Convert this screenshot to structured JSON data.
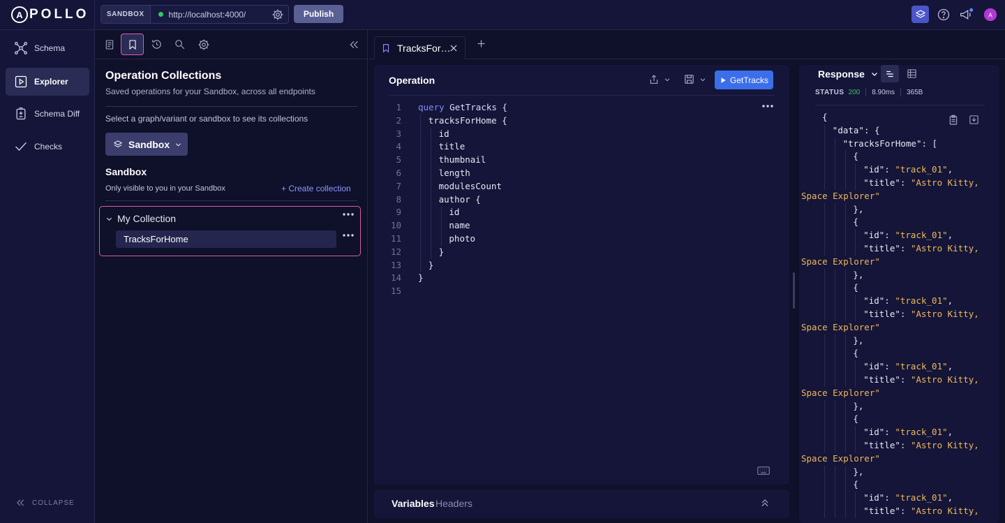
{
  "topbar": {
    "logo_text": "POLLO",
    "logo_letter": "A",
    "sandbox_badge": "SANDBOX",
    "url": "http://localhost:4000/",
    "publish_label": "Publish",
    "status_color": "#36c46a"
  },
  "nav": {
    "items": [
      {
        "label": "Schema",
        "icon": "schema-graph-icon"
      },
      {
        "label": "Explorer",
        "icon": "explorer-play-icon",
        "active": true
      },
      {
        "label": "Schema Diff",
        "icon": "schema-diff-icon"
      },
      {
        "label": "Checks",
        "icon": "checkmark-icon"
      }
    ],
    "collapse_label": "COLLAPSE"
  },
  "collections": {
    "title": "Operation Collections",
    "subtitle": "Saved operations for your Sandbox, across all endpoints",
    "select_hint": "Select a graph/variant or sandbox to see its collections",
    "dropdown_label": "Sandbox",
    "section_title": "Sandbox",
    "section_sub": "Only visible to you in your Sandbox",
    "create_label": "+ Create collection",
    "collection_name": "My Collection",
    "operations": [
      "TracksForHome"
    ]
  },
  "editor": {
    "tab_label": "TracksFor…",
    "panel_title": "Operation",
    "run_label": "GetTracks",
    "code_lines": [
      {
        "n": "1",
        "indent": 0,
        "kw": "query",
        "text": " GetTracks {"
      },
      {
        "n": "2",
        "indent": 1,
        "kw": "",
        "text": "tracksForHome {"
      },
      {
        "n": "3",
        "indent": 2,
        "kw": "",
        "text": "id"
      },
      {
        "n": "4",
        "indent": 2,
        "kw": "",
        "text": "title"
      },
      {
        "n": "5",
        "indent": 2,
        "kw": "",
        "text": "thumbnail"
      },
      {
        "n": "6",
        "indent": 2,
        "kw": "",
        "text": "length"
      },
      {
        "n": "7",
        "indent": 2,
        "kw": "",
        "text": "modulesCount"
      },
      {
        "n": "8",
        "indent": 2,
        "kw": "",
        "text": "author {"
      },
      {
        "n": "9",
        "indent": 3,
        "kw": "",
        "text": "id"
      },
      {
        "n": "10",
        "indent": 3,
        "kw": "",
        "text": "name"
      },
      {
        "n": "11",
        "indent": 3,
        "kw": "",
        "text": "photo"
      },
      {
        "n": "12",
        "indent": 2,
        "kw": "",
        "text": "}"
      },
      {
        "n": "13",
        "indent": 1,
        "kw": "",
        "text": "}"
      },
      {
        "n": "14",
        "indent": 0,
        "kw": "",
        "text": "}"
      },
      {
        "n": "15",
        "indent": 0,
        "kw": "",
        "text": ""
      }
    ],
    "variables_label": "Variables",
    "headers_label": "Headers"
  },
  "response": {
    "title": "Response",
    "status_label": "STATUS",
    "status_code": "200",
    "time": "8.90ms",
    "size": "365B",
    "lines": [
      {
        "indent": 0,
        "parts": [
          [
            "p",
            "{"
          ]
        ]
      },
      {
        "indent": 1,
        "parts": [
          [
            "k",
            "\"data\""
          ],
          [
            "p",
            ": {"
          ]
        ]
      },
      {
        "indent": 2,
        "parts": [
          [
            "k",
            "\"tracksForHome\""
          ],
          [
            "p",
            ": ["
          ]
        ]
      },
      {
        "indent": 3,
        "parts": [
          [
            "p",
            "{"
          ]
        ]
      },
      {
        "indent": 4,
        "parts": [
          [
            "k",
            "\"id\""
          ],
          [
            "p",
            ": "
          ],
          [
            "s",
            "\"track_01\""
          ],
          [
            "p",
            ","
          ]
        ]
      },
      {
        "indent": 4,
        "parts": [
          [
            "k",
            "\"title\""
          ],
          [
            "p",
            ": "
          ],
          [
            "s",
            "\"Astro Kitty,"
          ]
        ]
      },
      {
        "indent": -1,
        "parts": [
          [
            "s",
            "Space Explorer\""
          ]
        ]
      },
      {
        "indent": 3,
        "parts": [
          [
            "p",
            "},"
          ]
        ]
      },
      {
        "indent": 3,
        "parts": [
          [
            "p",
            "{"
          ]
        ]
      },
      {
        "indent": 4,
        "parts": [
          [
            "k",
            "\"id\""
          ],
          [
            "p",
            ": "
          ],
          [
            "s",
            "\"track_01\""
          ],
          [
            "p",
            ","
          ]
        ]
      },
      {
        "indent": 4,
        "parts": [
          [
            "k",
            "\"title\""
          ],
          [
            "p",
            ": "
          ],
          [
            "s",
            "\"Astro Kitty,"
          ]
        ]
      },
      {
        "indent": -1,
        "parts": [
          [
            "s",
            "Space Explorer\""
          ]
        ]
      },
      {
        "indent": 3,
        "parts": [
          [
            "p",
            "},"
          ]
        ]
      },
      {
        "indent": 3,
        "parts": [
          [
            "p",
            "{"
          ]
        ]
      },
      {
        "indent": 4,
        "parts": [
          [
            "k",
            "\"id\""
          ],
          [
            "p",
            ": "
          ],
          [
            "s",
            "\"track_01\""
          ],
          [
            "p",
            ","
          ]
        ]
      },
      {
        "indent": 4,
        "parts": [
          [
            "k",
            "\"title\""
          ],
          [
            "p",
            ": "
          ],
          [
            "s",
            "\"Astro Kitty,"
          ]
        ]
      },
      {
        "indent": -1,
        "parts": [
          [
            "s",
            "Space Explorer\""
          ]
        ]
      },
      {
        "indent": 3,
        "parts": [
          [
            "p",
            "},"
          ]
        ]
      },
      {
        "indent": 3,
        "parts": [
          [
            "p",
            "{"
          ]
        ]
      },
      {
        "indent": 4,
        "parts": [
          [
            "k",
            "\"id\""
          ],
          [
            "p",
            ": "
          ],
          [
            "s",
            "\"track_01\""
          ],
          [
            "p",
            ","
          ]
        ]
      },
      {
        "indent": 4,
        "parts": [
          [
            "k",
            "\"title\""
          ],
          [
            "p",
            ": "
          ],
          [
            "s",
            "\"Astro Kitty,"
          ]
        ]
      },
      {
        "indent": -1,
        "parts": [
          [
            "s",
            "Space Explorer\""
          ]
        ]
      },
      {
        "indent": 3,
        "parts": [
          [
            "p",
            "},"
          ]
        ]
      },
      {
        "indent": 3,
        "parts": [
          [
            "p",
            "{"
          ]
        ]
      },
      {
        "indent": 4,
        "parts": [
          [
            "k",
            "\"id\""
          ],
          [
            "p",
            ": "
          ],
          [
            "s",
            "\"track_01\""
          ],
          [
            "p",
            ","
          ]
        ]
      },
      {
        "indent": 4,
        "parts": [
          [
            "k",
            "\"title\""
          ],
          [
            "p",
            ": "
          ],
          [
            "s",
            "\"Astro Kitty,"
          ]
        ]
      },
      {
        "indent": -1,
        "parts": [
          [
            "s",
            "Space Explorer\""
          ]
        ]
      },
      {
        "indent": 3,
        "parts": [
          [
            "p",
            "},"
          ]
        ]
      },
      {
        "indent": 3,
        "parts": [
          [
            "p",
            "{"
          ]
        ]
      },
      {
        "indent": 4,
        "parts": [
          [
            "k",
            "\"id\""
          ],
          [
            "p",
            ": "
          ],
          [
            "s",
            "\"track_01\""
          ],
          [
            "p",
            ","
          ]
        ]
      },
      {
        "indent": 4,
        "parts": [
          [
            "k",
            "\"title\""
          ],
          [
            "p",
            ": "
          ],
          [
            "s",
            "\"Astro Kitty,"
          ]
        ]
      }
    ]
  },
  "colors": {
    "accent": "#3b6ee8",
    "highlight": "#d55fa8",
    "string": "#f0b85a",
    "keyword": "#7c8cff"
  }
}
